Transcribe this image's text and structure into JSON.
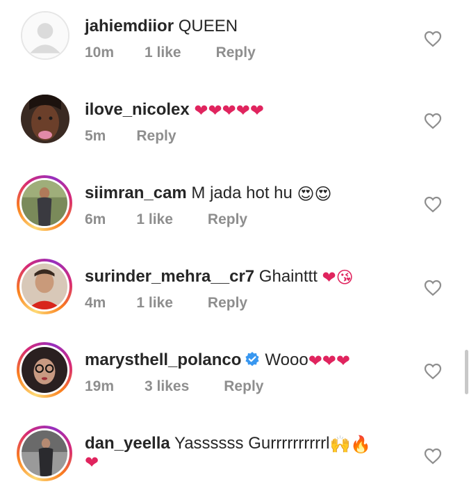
{
  "comments": [
    {
      "username": "jahiemdiior",
      "text": " QUEEN",
      "time": "10m",
      "likes": "1 like",
      "reply": "Reply"
    },
    {
      "username": "ilove_nicolex",
      "text": " ",
      "emojis": "❤❤❤❤❤",
      "time": "5m",
      "likes": "",
      "reply": "Reply"
    },
    {
      "username": "siimran_cam",
      "text": " M jada hot hu ",
      "emojis": "😍😍",
      "time": "6m",
      "likes": "1 like",
      "reply": "Reply"
    },
    {
      "username": "surinder_mehra__cr7",
      "text": " Ghainttt ",
      "emojis": "❤😘",
      "time": "4m",
      "likes": "1 like",
      "reply": "Reply"
    },
    {
      "username": "marysthell_polanco",
      "text": "Wooo",
      "emojis": "❤❤❤",
      "time": "19m",
      "likes": "3 likes",
      "reply": "Reply"
    },
    {
      "username": "dan_yeella",
      "text": " Yassssss Gurrrrrrrrrrl",
      "emojis": "🙌🔥",
      "emojis2": "❤"
    }
  ],
  "icons": {
    "heart": "heart-outline-icon",
    "verified": "verified-badge-icon"
  },
  "colors": {
    "ring_start": "#feda75",
    "ring_end": "#962fbf",
    "meta_gray": "#8e8e8e",
    "verified_blue": "#3897f0"
  }
}
